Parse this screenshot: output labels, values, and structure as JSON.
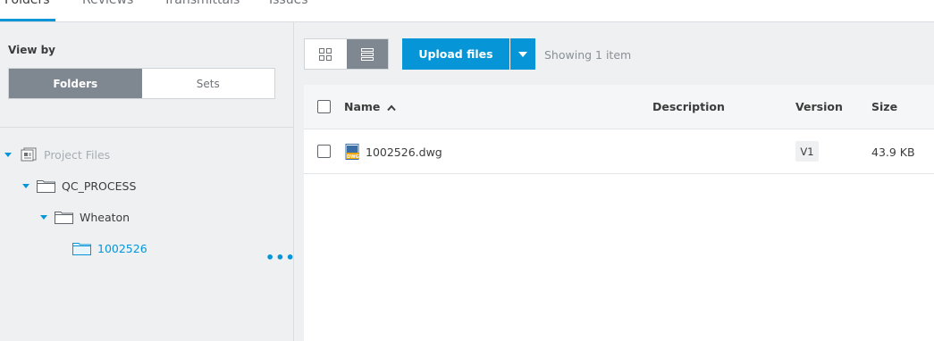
{
  "tabs": [
    {
      "label": "Folders",
      "active": true
    },
    {
      "label": "Reviews",
      "active": false
    },
    {
      "label": "Transmittals",
      "active": false
    },
    {
      "label": "Issues",
      "active": false
    }
  ],
  "sidebar": {
    "view_by_label": "View by",
    "segments": [
      {
        "label": "Folders",
        "active": true
      },
      {
        "label": "Sets",
        "active": false
      }
    ],
    "tree": [
      {
        "label": "Project Files",
        "icon": "project-files-icon",
        "expanded": true,
        "muted": true
      },
      {
        "label": "QC_PROCESS",
        "icon": "folder-icon",
        "expanded": true
      },
      {
        "label": "Wheaton",
        "icon": "folder-icon",
        "expanded": true
      },
      {
        "label": "1002526",
        "icon": "folder-icon",
        "selected": true
      }
    ],
    "more_label": "•••"
  },
  "toolbar": {
    "upload_label": "Upload files",
    "showing_text": "Showing 1 item",
    "accent_color": "#0696d7"
  },
  "table": {
    "columns": {
      "name": "Name",
      "description": "Description",
      "version": "Version",
      "size": "Size"
    },
    "sort_indicator": "^",
    "rows": [
      {
        "name": "1002526.dwg",
        "file_icon": "dwg-file-icon",
        "description": "",
        "version": "V1",
        "size": "43.9 KB"
      }
    ]
  }
}
